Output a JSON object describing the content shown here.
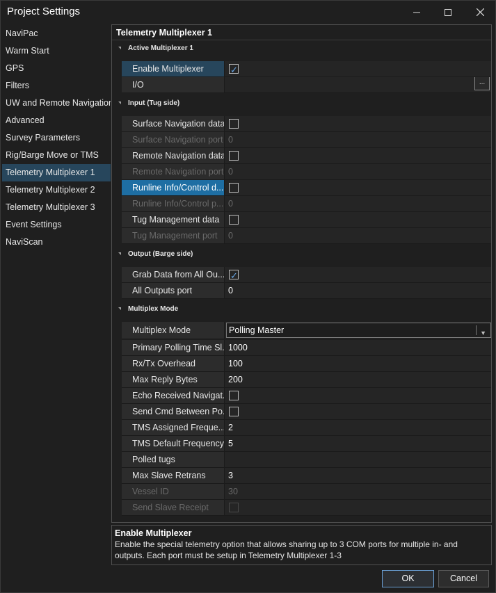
{
  "window": {
    "title": "Project Settings"
  },
  "sidebar": {
    "items": [
      {
        "label": "NaviPac"
      },
      {
        "label": "Warm Start"
      },
      {
        "label": "GPS"
      },
      {
        "label": "Filters"
      },
      {
        "label": "UW and Remote Navigation"
      },
      {
        "label": "Advanced"
      },
      {
        "label": "Survey Parameters"
      },
      {
        "label": "Rig/Barge Move or TMS"
      },
      {
        "label": "Telemetry Multiplexer 1"
      },
      {
        "label": "Telemetry Multiplexer 2"
      },
      {
        "label": "Telemetry Multiplexer 3"
      },
      {
        "label": "Event Settings"
      },
      {
        "label": "NaviScan"
      }
    ],
    "selected": "Telemetry Multiplexer 1"
  },
  "panel": {
    "title": "Telemetry Multiplexer 1",
    "categories": {
      "active": "Active Multiplexer 1",
      "input": "Input (Tug side)",
      "output": "Output (Barge side)",
      "mode": "Multiplex Mode"
    },
    "rows": {
      "enable_multiplexer": {
        "label": "Enable Multiplexer",
        "checked": true
      },
      "io": {
        "label": "I/O",
        "button": "..."
      },
      "surface_nav_data": {
        "label": "Surface Navigation data",
        "checked": false
      },
      "surface_nav_port": {
        "label": "Surface Navigation port",
        "value": "0"
      },
      "remote_nav_data": {
        "label": "Remote Navigation data",
        "checked": false
      },
      "remote_nav_port": {
        "label": "Remote Navigation port",
        "value": "0"
      },
      "runline_data": {
        "label": "Runline Info/Control d...",
        "checked": false
      },
      "runline_port": {
        "label": "Runline Info/Control p...",
        "value": "0"
      },
      "tug_mgmt_data": {
        "label": "Tug Management data",
        "checked": false
      },
      "tug_mgmt_port": {
        "label": "Tug Management port",
        "value": "0"
      },
      "grab_data": {
        "label": "Grab Data from All Ou...",
        "checked": true
      },
      "all_outputs_port": {
        "label": "All Outputs port",
        "value": "0"
      },
      "multiplex_mode": {
        "label": "Multiplex Mode",
        "value": "Polling Master"
      },
      "primary_polling": {
        "label": "Primary Polling Time Sl...",
        "value": "1000"
      },
      "rxtx_overhead": {
        "label": "Rx/Tx Overhead",
        "value": "100"
      },
      "max_reply_bytes": {
        "label": "Max Reply Bytes",
        "value": "200"
      },
      "echo_received": {
        "label": "Echo Received Navigat...",
        "checked": false
      },
      "send_cmd": {
        "label": "Send Cmd Between Po...",
        "checked": false
      },
      "tms_assigned": {
        "label": "TMS Assigned Freque...",
        "value": "2"
      },
      "tms_default": {
        "label": "TMS Default Frequency",
        "value": "5"
      },
      "polled_tugs": {
        "label": "Polled tugs",
        "value": ""
      },
      "max_slave_retrans": {
        "label": "Max Slave Retrans",
        "value": "3"
      },
      "vessel_id": {
        "label": "Vessel ID",
        "value": "30"
      },
      "send_slave_receipt": {
        "label": "Send Slave Receipt",
        "checked": false
      }
    }
  },
  "description": {
    "title": "Enable Multiplexer",
    "text": "Enable the special telemetry option that allows sharing up to 3 COM ports for multiple in- and outputs. Each port must be setup in Telemetry Multiplexer 1-3"
  },
  "buttons": {
    "ok": "OK",
    "cancel": "Cancel"
  },
  "colors": {
    "selection": "#1e6ea3",
    "sidebar_selection": "#27465c",
    "check": "#6aa8e8"
  }
}
